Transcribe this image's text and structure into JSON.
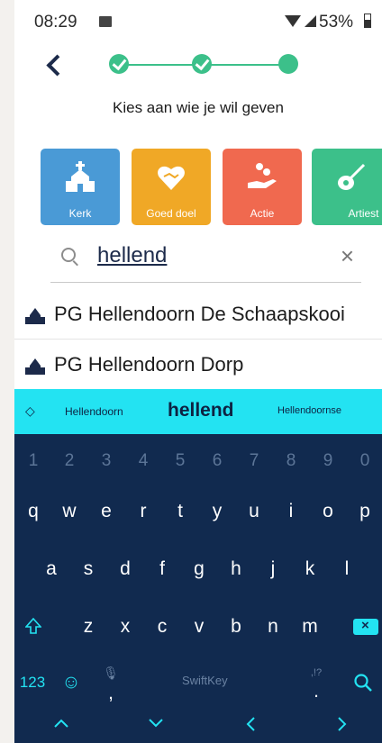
{
  "status_bar": {
    "time": "08:29",
    "battery": "53%"
  },
  "header": {
    "heading": "Kies aan wie je wil geven",
    "progress_steps_completed": 2,
    "progress_steps_total": 3
  },
  "categories": [
    {
      "label": "Kerk",
      "color": "#4a9ad6",
      "icon": "church-icon"
    },
    {
      "label": "Goed doel",
      "color": "#f0a826",
      "icon": "heart-hands-icon"
    },
    {
      "label": "Actie",
      "color": "#f0694f",
      "icon": "hand-coins-icon"
    },
    {
      "label": "Artiest",
      "color": "#3cc08a",
      "icon": "guitar-icon"
    }
  ],
  "search": {
    "value": "hellend",
    "clear_symbol": "×"
  },
  "results": [
    {
      "label": "PG Hellendoorn De Schaapskooi"
    },
    {
      "label": "PG Hellendoorn Dorp"
    }
  ],
  "keyboard": {
    "suggestions": [
      "Hellendoorn",
      "hellend",
      "Hellendoornse"
    ],
    "numbers": [
      "1",
      "2",
      "3",
      "4",
      "5",
      "6",
      "7",
      "8",
      "9",
      "0"
    ],
    "row1": [
      "q",
      "w",
      "e",
      "r",
      "t",
      "y",
      "u",
      "i",
      "o",
      "p"
    ],
    "row2": [
      "a",
      "s",
      "d",
      "f",
      "g",
      "h",
      "j",
      "k",
      "l"
    ],
    "row3": [
      "z",
      "x",
      "c",
      "v",
      "b",
      "n",
      "m"
    ],
    "numbers_key": "123",
    "brand": "SwiftKey",
    "punct_hint": ",!?",
    "comma": ",",
    "period": ".",
    "nav": [
      "^",
      "v",
      "<",
      ">"
    ],
    "accent_color": "#23e3f2"
  }
}
